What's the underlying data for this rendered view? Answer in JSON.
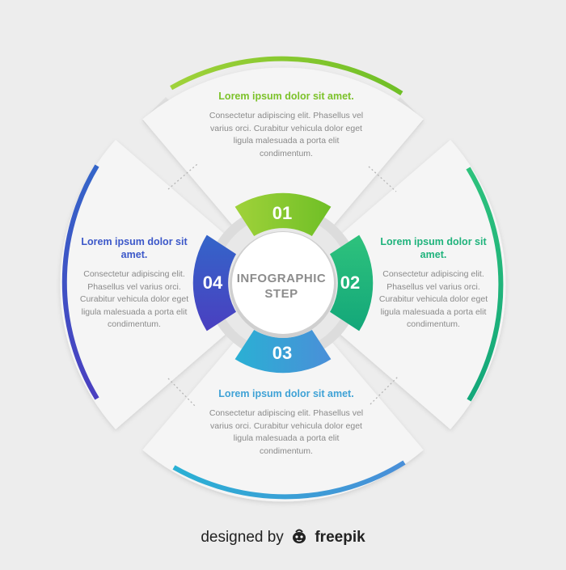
{
  "center": {
    "line1": "INFOGRAPHIC",
    "line2": "STEP"
  },
  "steps": [
    {
      "number": "01",
      "title": "Lorem ipsum dolor sit amet.",
      "body": "Consectetur adipiscing elit. Phasellus vel varius orci. Curabitur vehicula dolor eget ligula malesuada a porta elit condimentum."
    },
    {
      "number": "02",
      "title": "Lorem ipsum dolor sit amet.",
      "body": "Consectetur adipiscing elit. Phasellus vel varius orci. Curabitur vehicula dolor eget ligula malesuada a porta elit condimentum."
    },
    {
      "number": "03",
      "title": "Lorem ipsum dolor sit amet.",
      "body": "Consectetur adipiscing elit. Phasellus vel varius orci. Curabitur vehicula dolor eget ligula malesuada a porta elit condimentum."
    },
    {
      "number": "04",
      "title": "Lorem ipsum dolor sit amet.",
      "body": "Consectetur adipiscing elit. Phasellus vel varius orci. Curabitur vehicula dolor eget ligula malesuada a porta elit condimentum."
    }
  ],
  "colors": {
    "step1": "#7cc22a",
    "step2": "#1fb37c",
    "step3": "#3fa2d6",
    "step4": "#3c58c9",
    "background": "#ededed",
    "panel": "#f4f4f4"
  },
  "credit": {
    "prefix": "designed by",
    "brand": "freepik",
    "logo_icon": "freepik-logo-icon"
  }
}
